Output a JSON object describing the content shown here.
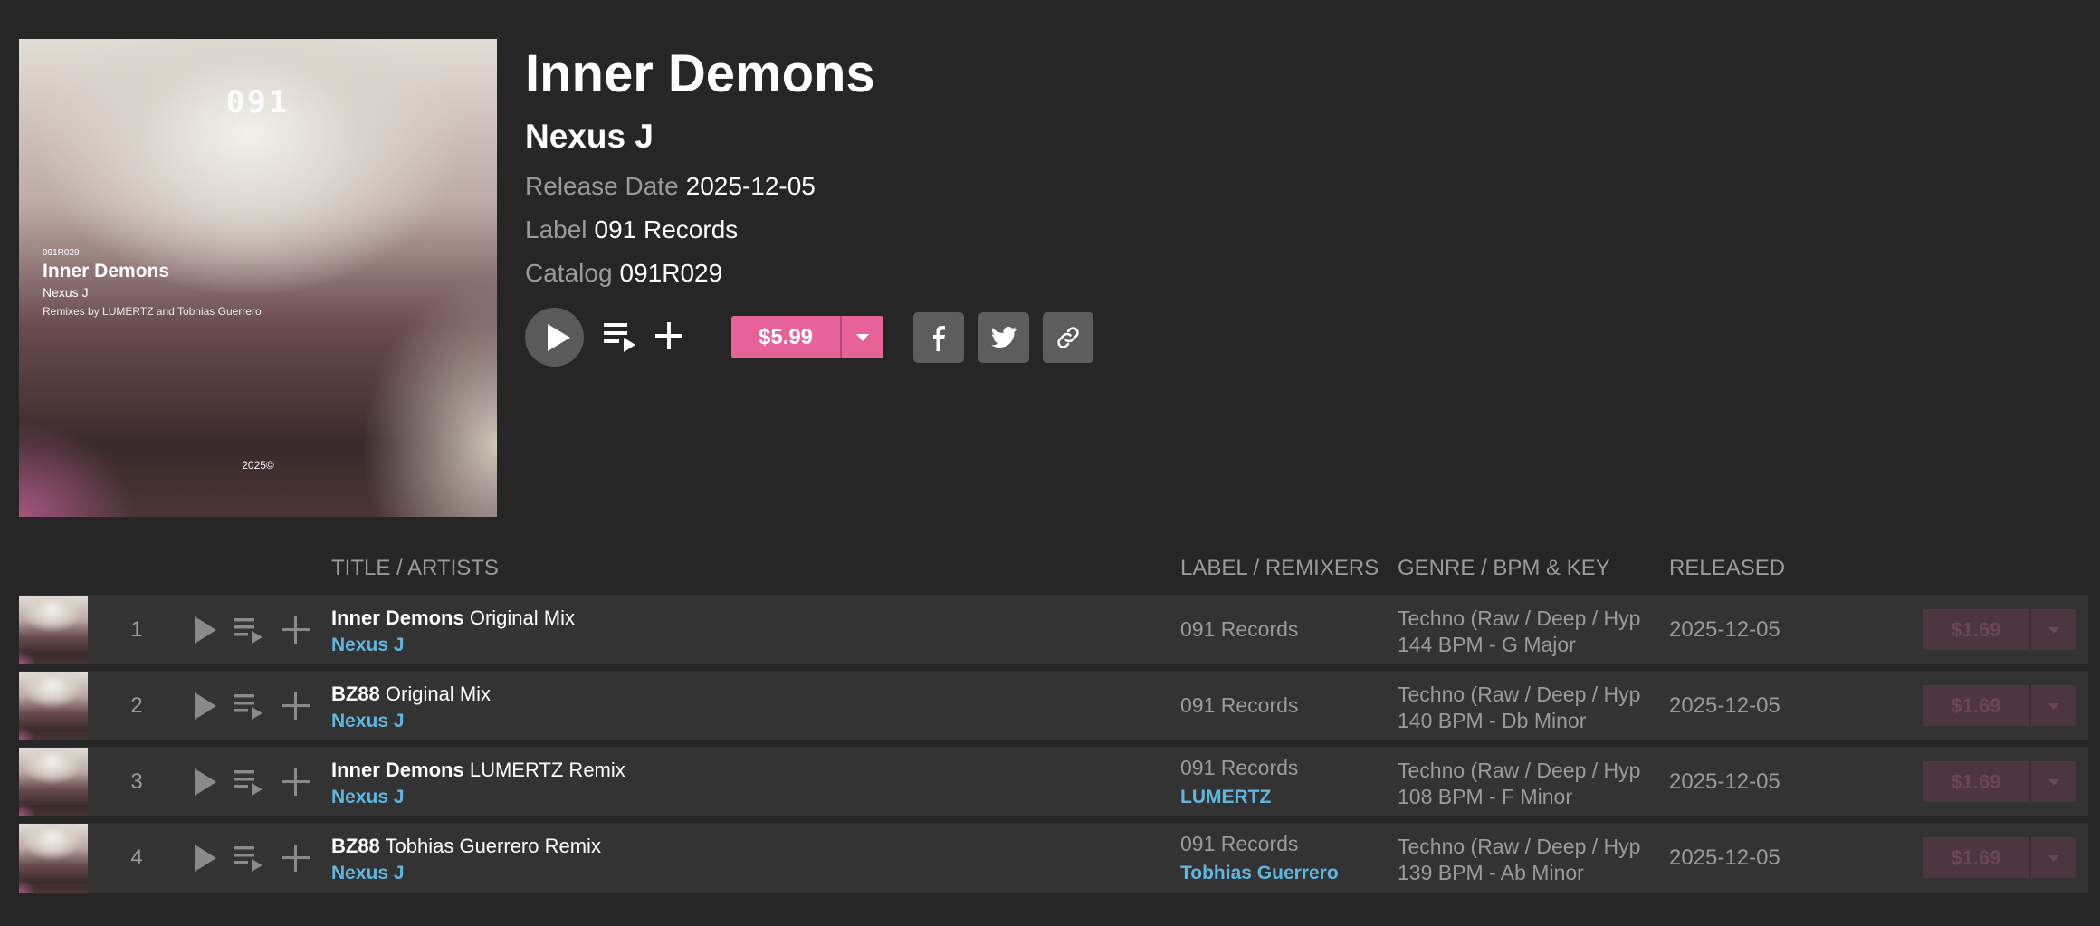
{
  "release": {
    "title": "Inner Demons",
    "artist": "Nexus J",
    "release_date_label": "Release Date",
    "release_date": "2025-12-05",
    "label_label": "Label",
    "label": "091 Records",
    "catalog_label": "Catalog",
    "catalog": "091R029",
    "price": "$5.99"
  },
  "cover": {
    "brand": "091",
    "catalog": "091R029",
    "title": "Inner Demons",
    "artist": "Nexus J",
    "remix_credit": "Remixes by LUMERTZ and Tobhias Guerrero",
    "year": "2025©"
  },
  "share": {
    "icons": [
      "facebook-icon",
      "twitter-icon",
      "link-icon"
    ]
  },
  "columns": {
    "title": "TITLE / ARTISTS",
    "label": "LABEL / REMIXERS",
    "genre": "GENRE / BPM & KEY",
    "released": "RELEASED"
  },
  "colors": {
    "accent": "#e8629a",
    "link": "#5fb7e0",
    "background": "#262626",
    "row": "#333333"
  },
  "tracks": [
    {
      "num": "1",
      "name": "Inner Demons",
      "mix": "Original Mix",
      "artist": "Nexus J",
      "label": "091 Records",
      "remixer": "",
      "genre": "Techno (Raw / Deep / Hypnotic)",
      "bpm_key": "144 BPM - G Major",
      "released": "2025-12-05",
      "price": "$1.69"
    },
    {
      "num": "2",
      "name": "BZ88",
      "mix": "Original Mix",
      "artist": "Nexus J",
      "label": "091 Records",
      "remixer": "",
      "genre": "Techno (Raw / Deep / Hypnotic)",
      "bpm_key": "140 BPM - Db Minor",
      "released": "2025-12-05",
      "price": "$1.69"
    },
    {
      "num": "3",
      "name": "Inner Demons",
      "mix": "LUMERTZ Remix",
      "artist": "Nexus J",
      "label": "091 Records",
      "remixer": "LUMERTZ",
      "genre": "Techno (Raw / Deep / Hypnotic)",
      "bpm_key": "108 BPM - F Minor",
      "released": "2025-12-05",
      "price": "$1.69"
    },
    {
      "num": "4",
      "name": "BZ88",
      "mix": "Tobhias Guerrero Remix",
      "artist": "Nexus J",
      "label": "091 Records",
      "remixer": "Tobhias Guerrero",
      "genre": "Techno (Raw / Deep / Hypnotic)",
      "bpm_key": "139 BPM - Ab Minor",
      "released": "2025-12-05",
      "price": "$1.69"
    }
  ]
}
